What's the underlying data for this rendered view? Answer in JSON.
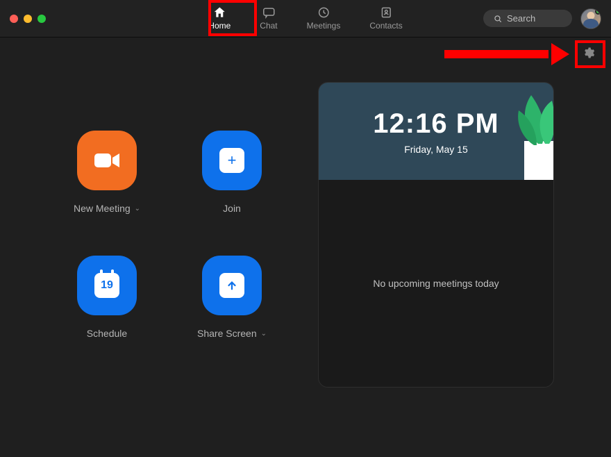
{
  "nav": {
    "tabs": [
      {
        "label": "Home",
        "active": true,
        "icon": "home-icon"
      },
      {
        "label": "Chat",
        "active": false,
        "icon": "chat-icon"
      },
      {
        "label": "Meetings",
        "active": false,
        "icon": "clock-icon"
      },
      {
        "label": "Contacts",
        "active": false,
        "icon": "contacts-icon"
      }
    ],
    "search_placeholder": "Search"
  },
  "actions": {
    "new_meeting": "New Meeting",
    "join": "Join",
    "schedule": "Schedule",
    "schedule_day": "19",
    "share_screen": "Share Screen"
  },
  "clock": {
    "time": "12:16 PM",
    "date": "Friday, May 15"
  },
  "upcoming": {
    "empty_text": "No upcoming meetings today"
  },
  "colors": {
    "orange": "#f26d21",
    "blue": "#0e71eb",
    "highlight": "#ff0000"
  }
}
